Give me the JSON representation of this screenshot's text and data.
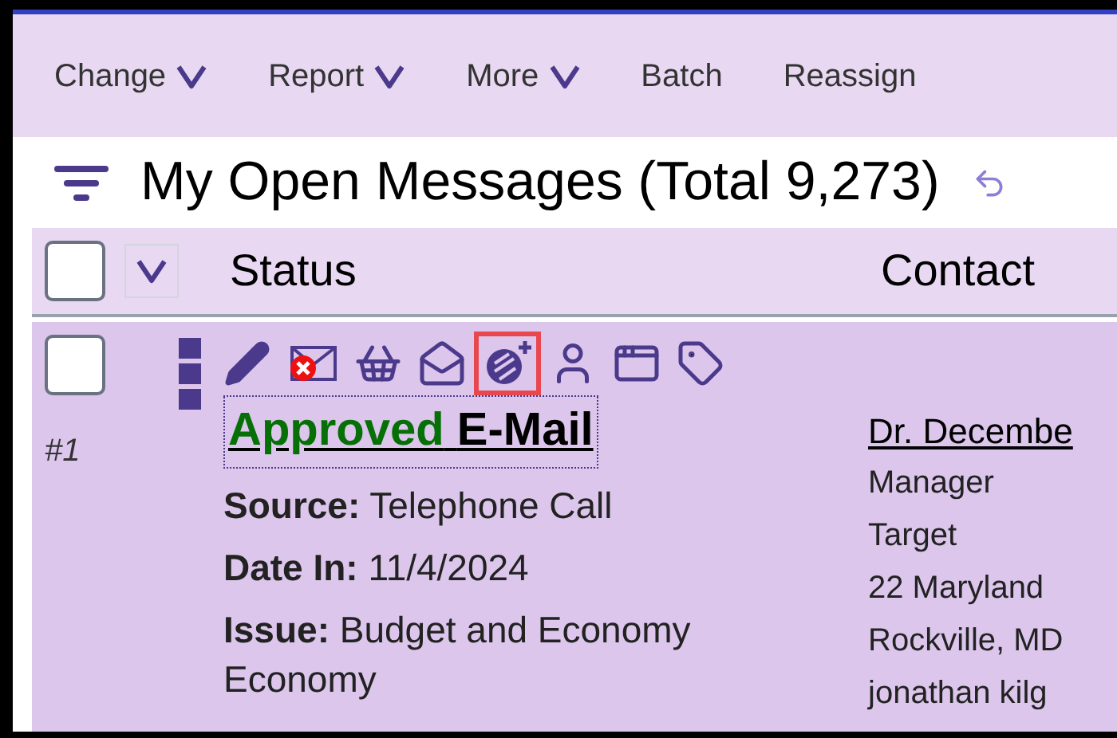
{
  "toolbar": [
    {
      "label": "Change",
      "dropdown": true
    },
    {
      "label": "Report",
      "dropdown": true
    },
    {
      "label": "More",
      "dropdown": true
    },
    {
      "label": "Batch",
      "dropdown": false
    },
    {
      "label": "Reassign",
      "dropdown": false
    }
  ],
  "title": "My Open Messages (Total 9,273)",
  "table": {
    "select_all": {
      "checked": false
    },
    "columns": [
      "Status",
      "Contact"
    ],
    "rows": [
      {
        "checked": false,
        "number": "#1",
        "actions": [
          {
            "kind": "edit",
            "highlighted": false
          },
          {
            "kind": "delete-mail",
            "highlighted": false
          },
          {
            "kind": "basket",
            "highlighted": false
          },
          {
            "kind": "letter",
            "highlighted": false
          },
          {
            "kind": "add-link",
            "highlighted": true
          },
          {
            "kind": "person",
            "highlighted": false
          },
          {
            "kind": "window",
            "highlighted": false
          },
          {
            "kind": "tag",
            "highlighted": false
          }
        ],
        "status": {
          "state": "Approved",
          "type": "E-Mail"
        },
        "details": [
          "**Source:** Telephone Call",
          "**Date In:** 11/4/2024",
          "**Issue:** Budget and Economy Economy"
        ],
        "contact": {
          "name": "Dr. Decembe",
          "lines": [
            "Manager",
            "Target",
            "22 Maryland",
            "Rockville, MD",
            "jonathan kilg"
          ]
        }
      }
    ]
  }
}
